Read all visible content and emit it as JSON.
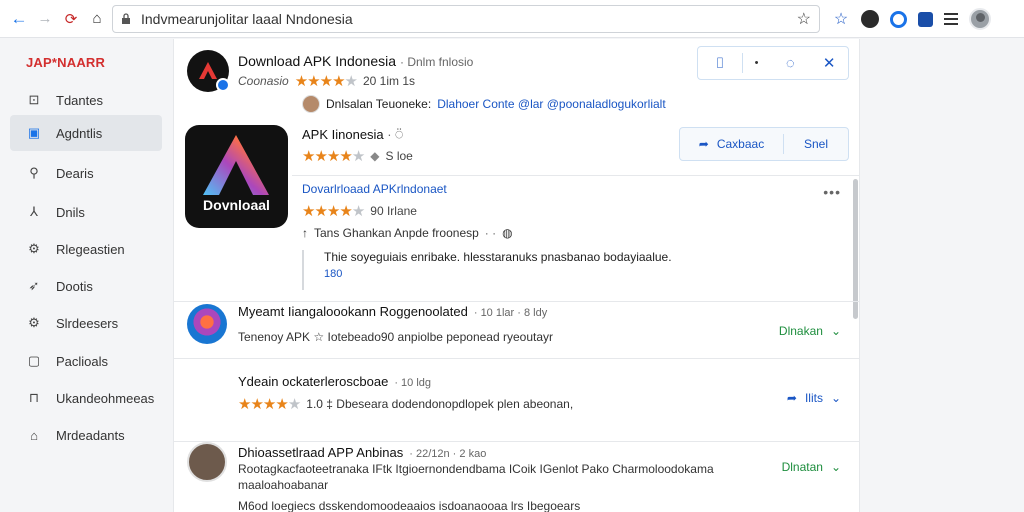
{
  "browser": {
    "url": "Indvmearunjolitar laaal Nndonesia"
  },
  "sidebar": {
    "brand": "JAP*NAARR",
    "items": [
      {
        "label": "Tdantes",
        "icon": "image-icon",
        "active": false
      },
      {
        "label": "Agdntlis",
        "icon": "apps-icon",
        "active": true
      },
      {
        "label": "Dearis",
        "icon": "pin-icon",
        "active": false
      },
      {
        "label": "Dnils",
        "icon": "fork-icon",
        "active": false
      },
      {
        "label": "Rlegeastien",
        "icon": "settings-icon",
        "active": false
      },
      {
        "label": "Dootis",
        "icon": "send-icon",
        "active": false
      },
      {
        "label": "Slrdeesers",
        "icon": "gear-icon",
        "active": false
      },
      {
        "label": "Paclioals",
        "icon": "box-icon",
        "active": false
      },
      {
        "label": "Ukandeohmeeas",
        "icon": "inbox-icon",
        "active": false
      },
      {
        "label": "Mrdeadants",
        "icon": "shield-icon",
        "active": false
      }
    ]
  },
  "top_app": {
    "title": "Download APK Indonesia",
    "title_extra": "· Dnlm fnlosio",
    "rating_label": "Coonasio",
    "rating_stars": 4,
    "rating_meta": "20 1im 1s",
    "dev_name": "Dnlsalan Teuoneke:",
    "dev_link": "Dlahoer Conte @lar @poonaladlogukorlialt"
  },
  "big_app": {
    "icon_word": "Dovnloaal",
    "title": "APK Iinonesia",
    "title_extra": "· ⍥",
    "rating_stars": 4,
    "rating_meta": "S loe",
    "share_label": "Caxbaac",
    "send_label": "Snel"
  },
  "detail": {
    "title": "Dovarlrloaad APKrlndonaet",
    "rating_stars": 4,
    "rating_meta": "90 Irlane",
    "meta_text": "Tans Ghankan Anpde froonesp",
    "body": "Thie soyeguiais enribake. hlesstaranuks pnasbanao bodayiaalue.",
    "body_num": "180"
  },
  "rows": [
    {
      "title": "Myeamt Iiangaloookann Roggenoolated",
      "title_extra": "· 10 1lar · 8 ldy",
      "line": "Tenenoy APK ☆   Iotebeado90 anpiolbe peponead ryeoutayr",
      "action": "Dlnakan",
      "action_color": "#1e8e3e",
      "avatar": "gradient"
    },
    {
      "title": "Ydeain ockaterleroscboae",
      "title_extra": "· 10 ldg",
      "line_stars": 4,
      "line": "1.0 ‡ Dbeseara dodendonopdlopek plen abeonan,",
      "action": "Ilits",
      "action_color": "#1a56c4",
      "avatar": "none"
    },
    {
      "title": "Dhioassetlraad APP Anbinas",
      "title_extra": "· 22/12n · 2 kao",
      "line_link": "Rootagkacfaoteetranaka IFtk Itgioernondendbama ICoik IGenlot Pako Charmoloodokama",
      "line_link2": "maaloahoabanar",
      "line": "M6od loegiecs dsskendomoodeaaios isdoanaooaa lrs Ibegoears",
      "action": "Dlnatan",
      "action_color": "#1e8e3e",
      "avatar": "photo"
    }
  ],
  "colors": {
    "accent": "#1a56c4",
    "brand_red": "#d32f2f",
    "star": "#e8841a",
    "green_action": "#1e8e3e"
  }
}
